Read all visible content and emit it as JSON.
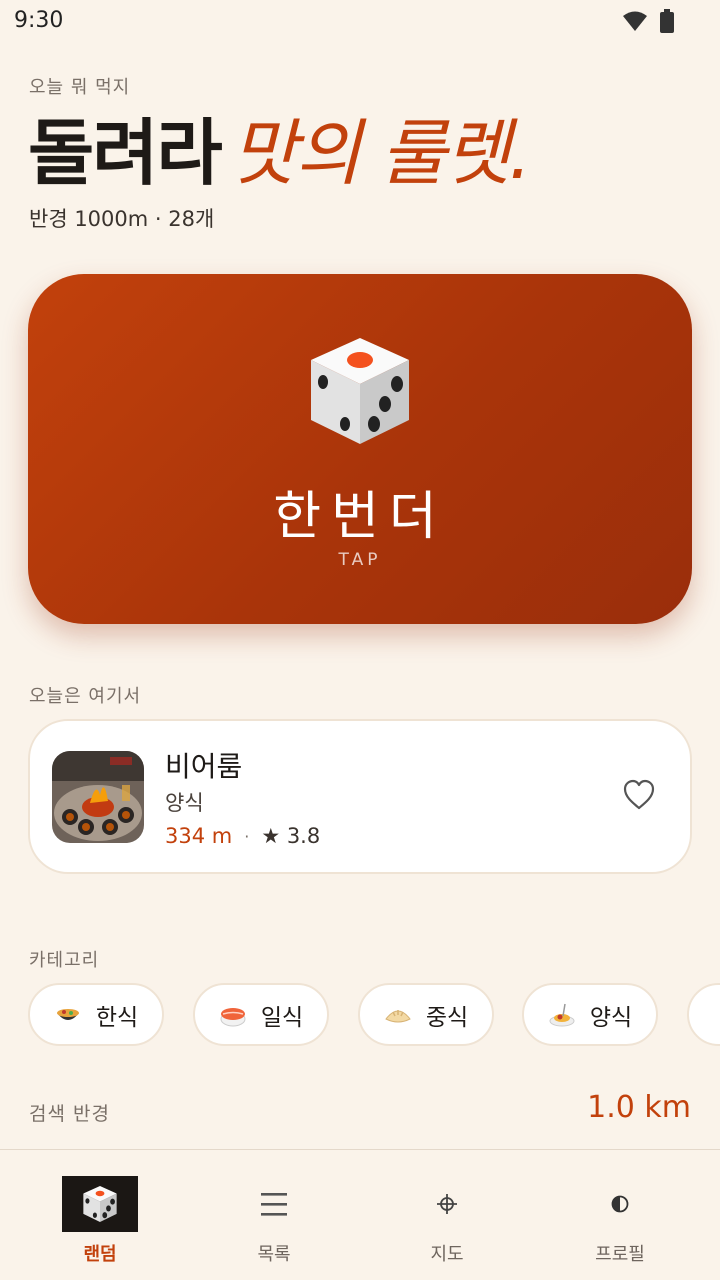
{
  "status_bar": {
    "time": "9:30"
  },
  "header": {
    "eyebrow": "오늘 뭐 먹지",
    "title_main": "돌려라",
    "title_accent": "맛의 룰렛.",
    "subtitle": "반경 1000m · 28개"
  },
  "hero": {
    "label": "한번더",
    "tap": "TAP",
    "icon": "dice-icon"
  },
  "today_pick": {
    "section_label": "오늘은 여기서",
    "name": "비어룸",
    "category": "양식",
    "distance": "334 m",
    "separator": "·",
    "rating": "★ 3.8",
    "favorite_icon": "heart-outline-icon"
  },
  "categories": {
    "section_label": "카테고리",
    "items": [
      {
        "label": "한식",
        "icon": "stew-pot-icon"
      },
      {
        "label": "일식",
        "icon": "sushi-icon"
      },
      {
        "label": "중식",
        "icon": "dumpling-icon"
      },
      {
        "label": "양식",
        "icon": "spaghetti-icon"
      }
    ]
  },
  "search_radius": {
    "label": "검색 반경",
    "value": "1.0 km"
  },
  "bottom_nav": [
    {
      "label": "랜덤",
      "icon": "dice-icon",
      "active": true
    },
    {
      "label": "목록",
      "icon": "list-icon",
      "active": false
    },
    {
      "label": "지도",
      "icon": "crosshair-icon",
      "active": false
    },
    {
      "label": "프로필",
      "icon": "half-circle-icon",
      "active": false
    }
  ],
  "colors": {
    "background": "#FAF3EA",
    "accent": "#C2410C",
    "card": "#FFFFFF",
    "text": "#1E1A17",
    "muted": "#7A7068"
  }
}
